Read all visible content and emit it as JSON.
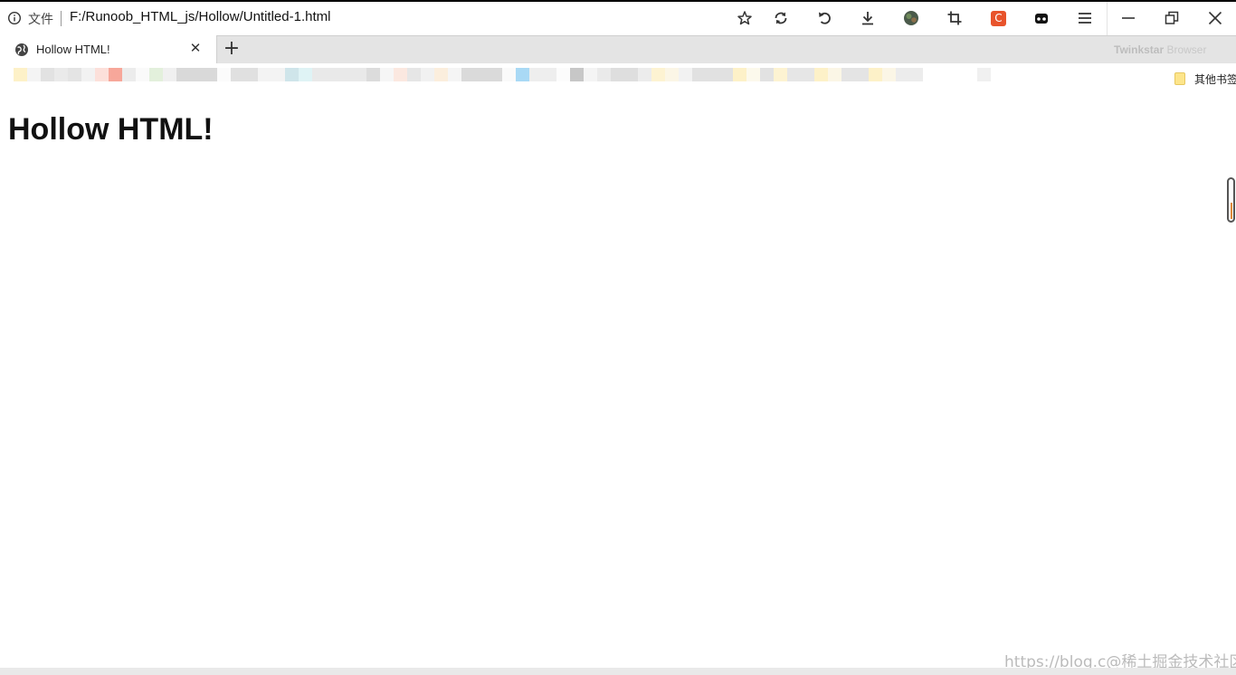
{
  "address_bar": {
    "file_label": "文件",
    "url": "F:/Runoob_HTML_js/Hollow/Untitled-1.html"
  },
  "toolbar": {
    "icons": [
      "star-icon",
      "sync-icon",
      "undo-icon",
      "download-icon",
      "avatar-icon",
      "crop-icon",
      "extension-c-icon",
      "extension-mask-icon",
      "menu-icon"
    ],
    "extension_letter": "C",
    "extension_color": "#e8532b"
  },
  "window_controls": [
    "minimize-icon",
    "restore-icon",
    "close-icon"
  ],
  "tabs": [
    {
      "title": "Hollow HTML!",
      "active": true
    }
  ],
  "tab_bar": {
    "new_tab": "+",
    "close_glyph": "✕",
    "brand_bold": "Twinkstar",
    "brand_light": " Browser"
  },
  "bookmarks": {
    "other_label": "其他书签"
  },
  "page": {
    "heading": "Hollow HTML!"
  },
  "watermark": "https://blog.c@稀土掘金技术社区"
}
